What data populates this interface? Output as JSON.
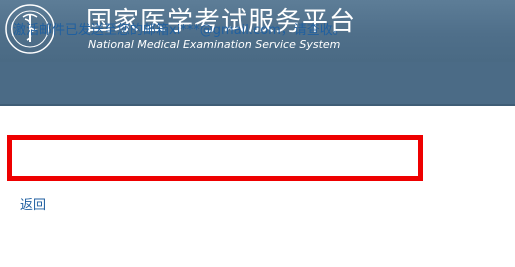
{
  "header": {
    "title_cn": "国家医学考试服务平台",
    "title_en": "National Medical Examination Service System",
    "logo_icon": "medical-caduceus-seal-icon"
  },
  "message": {
    "text": "激活邮件已发送至您的邮箱xi***@gmail.com，请查收。"
  },
  "actions": {
    "back_label": "返回"
  },
  "colors": {
    "header_bg": "#4f6f8a",
    "highlight_border": "#ee0000",
    "text_blue": "#2060a0"
  }
}
